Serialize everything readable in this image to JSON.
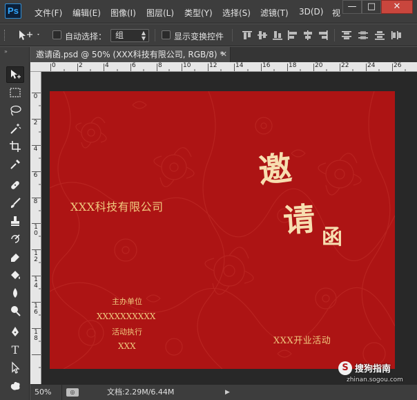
{
  "app": {
    "logo": "Ps"
  },
  "menu": [
    "文件(F)",
    "编辑(E)",
    "图像(I)",
    "图层(L)",
    "类型(Y)",
    "选择(S)",
    "滤镜(T)",
    "3D(D)",
    "视"
  ],
  "window_controls": {
    "minimize": "—",
    "maximize": "□",
    "close": "✕"
  },
  "options_bar": {
    "move_tool_icon": "move-arrow-icon",
    "auto_select_label": "自动选择：",
    "auto_select_checked": false,
    "auto_select_value": "组",
    "show_transform_label": "显示变换控件",
    "show_transform_checked": false
  },
  "document": {
    "tab_title": "邀请函.psd @ 50% (XXX科技有限公司, RGB/8) *",
    "close": "✕"
  },
  "ruler_top": [
    "0",
    "2",
    "4",
    "6",
    "8",
    "10",
    "12",
    "14",
    "16",
    "18",
    "20",
    "22",
    "24",
    "26"
  ],
  "ruler_left": [
    "0",
    "2",
    "4",
    "6",
    "8",
    "10",
    "12",
    "14",
    "16",
    "18"
  ],
  "invitation": {
    "company": "XXX科技有限公司",
    "title_char1": "邀",
    "title_char2": "请",
    "title_char3": "函",
    "host_label": "主办单位",
    "host_value": "XXXXXXXXXX",
    "exec_label": "活动执行",
    "exec_value": "XXX",
    "event": "XXX开业活动"
  },
  "status": {
    "zoom": "50%",
    "doc_info": "文档:2.29M/6.44M",
    "arrow": "▶"
  },
  "watermark": {
    "icon": "S",
    "title": "搜狗指南",
    "url": "zhinan.sogou.com"
  },
  "colors": {
    "canvas_red": "#ad1414",
    "gold_text": "#f0c97e",
    "chrome_dark": "#3d3d3d"
  }
}
